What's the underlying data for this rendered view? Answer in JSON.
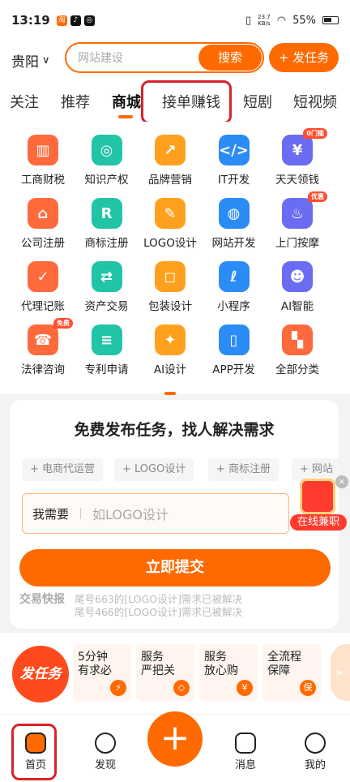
{
  "status": {
    "time": "13:19",
    "speed_top": "23.7",
    "speed_unit": "KB/s",
    "battery": "55%"
  },
  "header": {
    "city": "贵阳",
    "search_placeholder": "网站建设",
    "search_button": "搜索",
    "post_button": "+ 发任务"
  },
  "tabs": [
    "关注",
    "推荐",
    "商城",
    "接单赚钱",
    "短剧",
    "短视频"
  ],
  "active_tab": "商城",
  "grid": [
    {
      "label": "工商财税",
      "icon": "building-icon",
      "color": "#ff6a3d",
      "glyph": "▥"
    },
    {
      "label": "知识产权",
      "icon": "ip-icon",
      "color": "#22c4a6",
      "glyph": "◎"
    },
    {
      "label": "品牌营销",
      "icon": "chart-up-icon",
      "color": "#ffa11f",
      "glyph": "↗"
    },
    {
      "label": "IT开发",
      "icon": "code-monitor-icon",
      "color": "#2b8cf5",
      "glyph": "</>"
    },
    {
      "label": "天天领钱",
      "icon": "money-bag-icon",
      "color": "#6a6df2",
      "glyph": "¥",
      "tag": "0门槛"
    },
    {
      "label": "公司注册",
      "icon": "home-icon",
      "color": "#ff6a3d",
      "glyph": "⌂"
    },
    {
      "label": "商标注册",
      "icon": "trademark-icon",
      "color": "#22c4a6",
      "glyph": "R"
    },
    {
      "label": "LOGO设计",
      "icon": "palette-icon",
      "color": "#ffa11f",
      "glyph": "✎"
    },
    {
      "label": "网站开发",
      "icon": "globe-icon",
      "color": "#2b8cf5",
      "glyph": "◍"
    },
    {
      "label": "上门按摩",
      "icon": "massage-icon",
      "color": "#6a6df2",
      "glyph": "♨",
      "tag": "优惠"
    },
    {
      "label": "代理记账",
      "icon": "ledger-icon",
      "color": "#ff6a3d",
      "glyph": "✓"
    },
    {
      "label": "资产交易",
      "icon": "exchange-icon",
      "color": "#22c4a6",
      "glyph": "⇄"
    },
    {
      "label": "包装设计",
      "icon": "bag-icon",
      "color": "#ffa11f",
      "glyph": "◻"
    },
    {
      "label": "小程序",
      "icon": "mini-program-icon",
      "color": "#2b8cf5",
      "glyph": "ℓ"
    },
    {
      "label": "AI智能",
      "icon": "robot-icon",
      "color": "#6a6df2",
      "glyph": "☻"
    },
    {
      "label": "法律咨询",
      "icon": "lawyer-icon",
      "color": "#ff6a3d",
      "glyph": "☎",
      "tag": "免费"
    },
    {
      "label": "专利申请",
      "icon": "patent-icon",
      "color": "#22c4a6",
      "glyph": "≡"
    },
    {
      "label": "AI设计",
      "icon": "magic-wand-icon",
      "color": "#ffa11f",
      "glyph": "✦"
    },
    {
      "label": "APP开发",
      "icon": "app-icon",
      "color": "#2b8cf5",
      "glyph": "▯"
    },
    {
      "label": "全部分类",
      "icon": "all-categories-icon",
      "color": "#ff6a3d",
      "glyph": "▚"
    }
  ],
  "card": {
    "title": "免费发布任务，找人解决需求",
    "chips": [
      "+ 电商代运营",
      "+ LOGO设计",
      "+ 商标注册",
      "+ 网站"
    ],
    "need_label": "我需要",
    "need_placeholder": "如LOGO设计",
    "submit": "立即提交",
    "ticker_label": "交易快报",
    "ticker_lines": [
      "尾号663的[LOGO设计]需求已被解决",
      "尾号466的[LOGO设计]需求已被解决"
    ],
    "promo_badge": "在线兼职"
  },
  "features": {
    "post_badge": "发任务",
    "items": [
      {
        "text": "5分钟\n有求必",
        "icon": "lightning-icon",
        "glyph": "⚡"
      },
      {
        "text": "服务\n严把关",
        "icon": "diamond-icon",
        "glyph": "◇"
      },
      {
        "text": "服务\n放心购",
        "icon": "yen-icon",
        "glyph": "¥"
      },
      {
        "text": "全流程\n保障",
        "icon": "shield-icon",
        "glyph": "保"
      }
    ]
  },
  "nav": [
    {
      "label": "首页",
      "icon": "home-icon"
    },
    {
      "label": "发现",
      "icon": "planet-icon"
    },
    {
      "label": "消息",
      "icon": "message-icon"
    },
    {
      "label": "我的",
      "icon": "profile-icon"
    }
  ]
}
